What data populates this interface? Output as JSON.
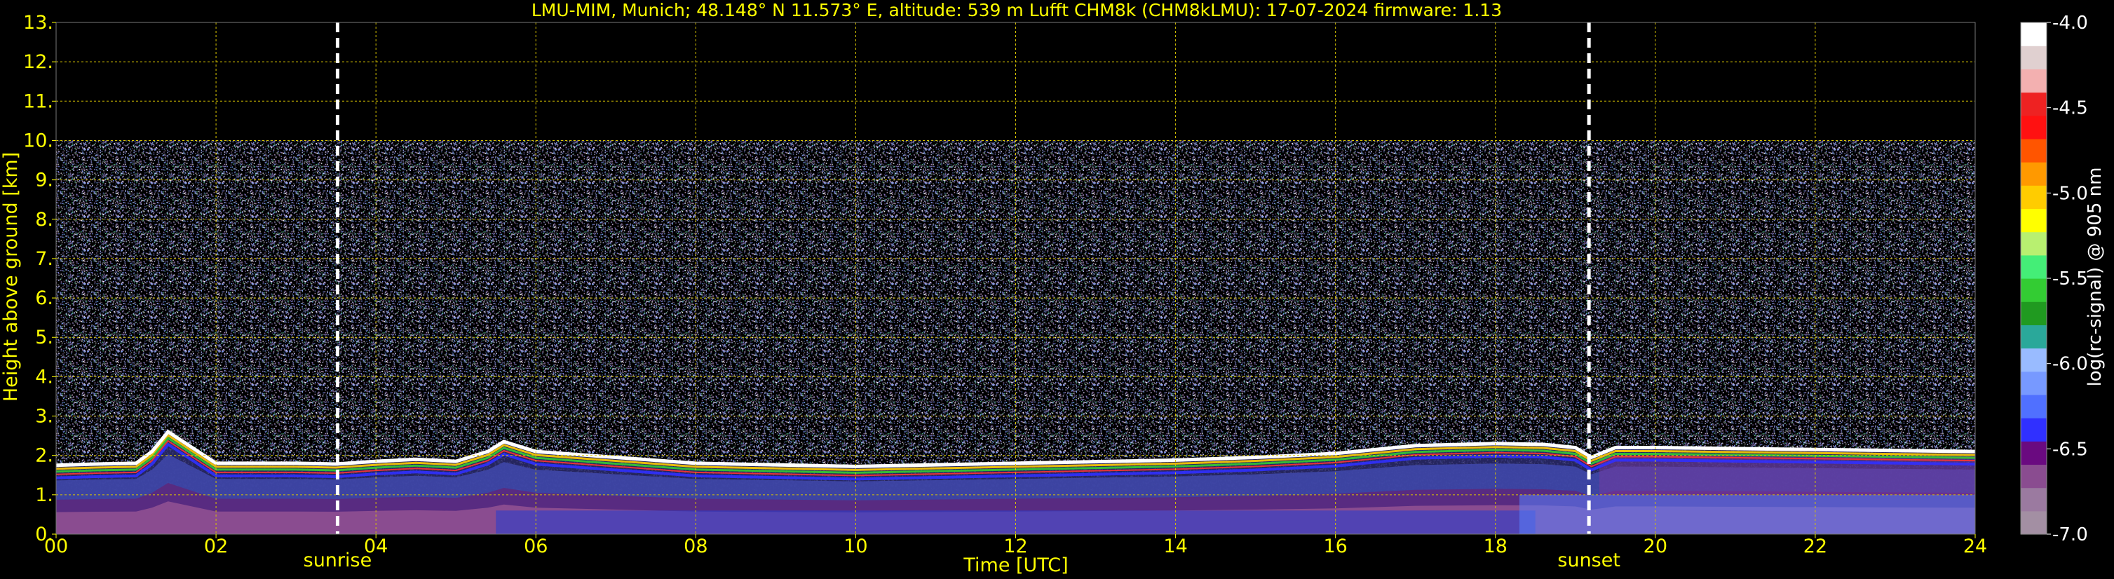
{
  "chart_data": {
    "type": "heatmap",
    "title": "LMU-MIM, Munich; 48.148° N 11.573° E, altitude: 539 m    Lufft CHM8k (CHM8kLMU): 17-07-2024    firmware: 1.13",
    "xlabel": "Time [UTC]",
    "ylabel": "Height above ground [km]",
    "colorbar_label": "log(rc-signal) @ 905 nm",
    "xlim": [
      0,
      24
    ],
    "ylim": [
      0,
      13
    ],
    "x_ticks": [
      "00",
      "02",
      "04",
      "06",
      "08",
      "10",
      "12",
      "14",
      "16",
      "18",
      "20",
      "22",
      "24"
    ],
    "y_ticks": [
      "0.",
      "1.",
      "2.",
      "3.",
      "4.",
      "5.",
      "6.",
      "7.",
      "8.",
      "9.",
      "10.",
      "11.",
      "12.",
      "13."
    ],
    "grid": true,
    "signal_ceiling_km": 10.0,
    "events": [
      {
        "label": "sunrise",
        "time_utc": 3.52
      },
      {
        "label": "sunset",
        "time_utc": 19.17
      }
    ],
    "boundary_layer_top_km": {
      "time_utc": [
        0,
        0.5,
        1.0,
        1.2,
        1.4,
        2.0,
        3.0,
        3.5,
        4.0,
        4.5,
        5.0,
        5.4,
        5.6,
        6,
        8,
        10,
        12,
        14,
        15,
        16,
        17,
        18,
        18.6,
        19,
        19.2,
        19.5,
        20,
        22,
        24
      ],
      "height_km": [
        1.75,
        1.78,
        1.8,
        2.1,
        2.6,
        1.8,
        1.8,
        1.78,
        1.85,
        1.9,
        1.85,
        2.1,
        2.35,
        2.1,
        1.8,
        1.72,
        1.8,
        1.88,
        1.95,
        2.05,
        2.25,
        2.3,
        2.28,
        2.2,
        1.95,
        2.2,
        2.2,
        2.15,
        2.1
      ]
    },
    "colorbar": {
      "min": -7.0,
      "max": -4.0,
      "ticks": [
        "-4.0",
        "-4.5",
        "-5.0",
        "-5.5",
        "-6.0",
        "-6.5",
        "-7.0"
      ],
      "colors": [
        "#a38fa3",
        "#9b7aa0",
        "#8a4c90",
        "#6a0a80",
        "#3030ff",
        "#5070ff",
        "#7799ff",
        "#99bbff",
        "#2aa89a",
        "#209a20",
        "#33cc33",
        "#44ee77",
        "#b8f070",
        "#ffff00",
        "#ffcc00",
        "#ff9900",
        "#ff5500",
        "#ff1111",
        "#ee2222",
        "#f3b0b0",
        "#e0d0d0",
        "#ffffff"
      ]
    }
  }
}
